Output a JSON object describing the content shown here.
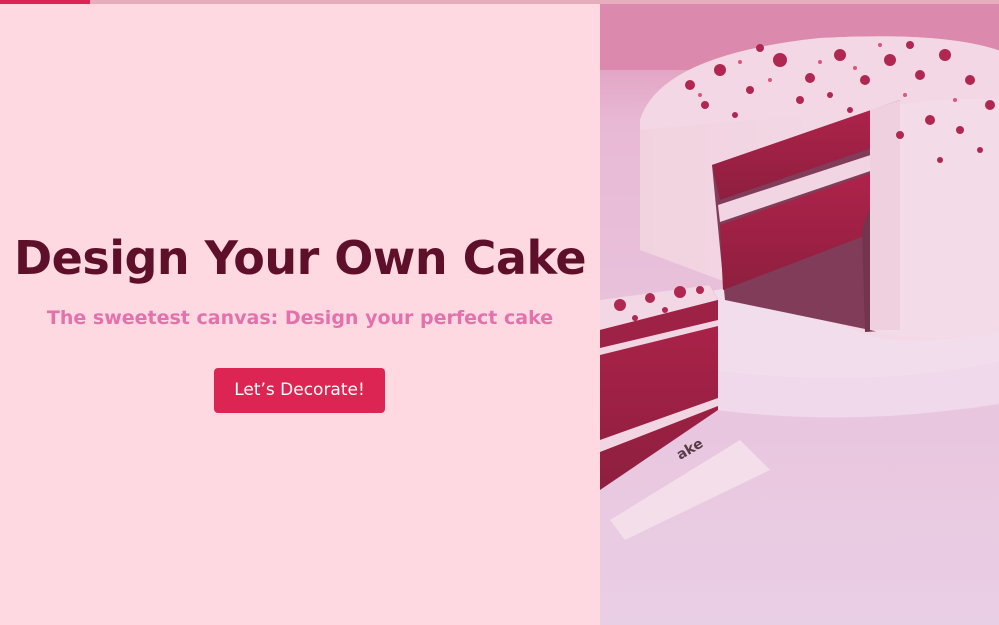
{
  "progress": {
    "value_percent": 9,
    "track_color": "#e6aebc",
    "fill_color": "#dc2552"
  },
  "hero": {
    "title": "Design Your Own Cake",
    "subtitle": "The sweetest canvas: Design your perfect cake",
    "cta_label": "Let’s Decorate!",
    "background_color": "#ffd9e2",
    "title_color": "#5e0f2a",
    "subtitle_color": "#e271ac",
    "accent_color": "#dc2552"
  },
  "image": {
    "subject": "red-velvet-cake",
    "board_text": "ake"
  }
}
